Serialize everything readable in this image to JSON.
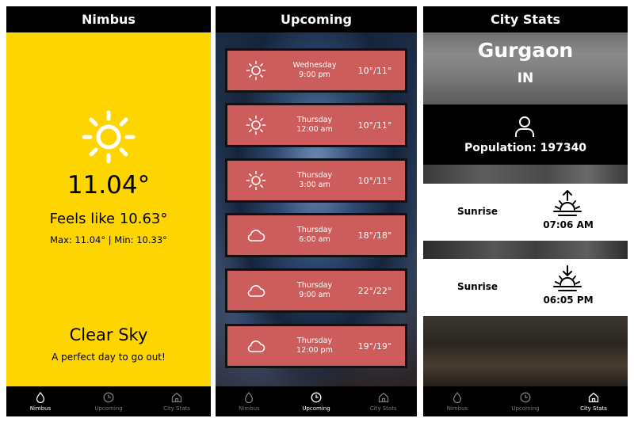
{
  "screens": {
    "nimbus": {
      "header_title": "Nimbus",
      "weather_icon": "sun-icon",
      "temperature": "11.04°",
      "feels_like": "Feels like 10.63°",
      "min_max": "Max: 11.04° | Min: 10.33°",
      "condition": "Clear Sky",
      "tagline": "A perfect day to go out!",
      "background_color": "#ffd500"
    },
    "upcoming": {
      "header_title": "Upcoming",
      "card_color": "#cd5c5c",
      "forecasts": [
        {
          "icon": "sun-icon",
          "day": "Wednesday",
          "time": "9:00 pm",
          "temps": "10°/11°"
        },
        {
          "icon": "sun-icon",
          "day": "Thursday",
          "time": "12:00 am",
          "temps": "10°/11°"
        },
        {
          "icon": "sun-icon",
          "day": "Thursday",
          "time": "3:00 am",
          "temps": "10°/11°"
        },
        {
          "icon": "cloud-icon",
          "day": "Thursday",
          "time": "6:00 am",
          "temps": "18°/18°"
        },
        {
          "icon": "cloud-icon",
          "day": "Thursday",
          "time": "9:00 am",
          "temps": "22°/22°"
        },
        {
          "icon": "cloud-icon",
          "day": "Thursday",
          "time": "12:00 pm",
          "temps": "19°/19°"
        }
      ]
    },
    "city_stats": {
      "header_title": "City Stats",
      "city": "Gurgaon",
      "country": "IN",
      "population_icon": "person-icon",
      "population": "Population: 197340",
      "sunrise": {
        "label": "Sunrise",
        "icon": "sunrise-icon",
        "time": "07:06 AM"
      },
      "sunset": {
        "label": "Sunrise",
        "icon": "sunset-icon",
        "time": "06:05 PM"
      }
    }
  },
  "tabs": [
    {
      "label": "Nimbus",
      "icon": "drop-icon"
    },
    {
      "label": "Upcoming",
      "icon": "clock-icon"
    },
    {
      "label": "City Stats",
      "icon": "home-icon"
    }
  ]
}
